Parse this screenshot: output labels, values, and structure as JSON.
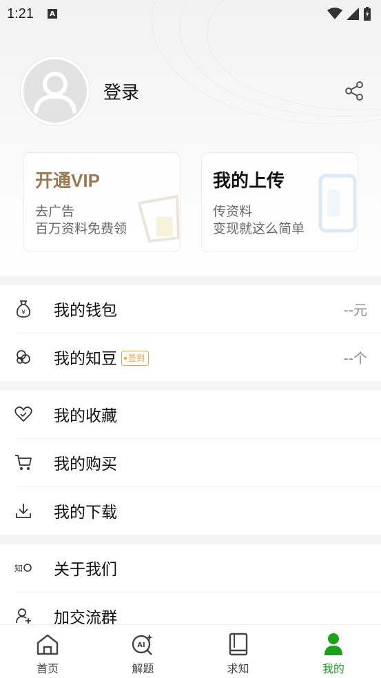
{
  "status_bar": {
    "time": "1:21",
    "notification_letter": "A"
  },
  "profile": {
    "login_label": "登录"
  },
  "cards": {
    "vip": {
      "title": "开通VIP",
      "line1": "去广告",
      "line2": "百万资料免费领"
    },
    "upload": {
      "title": "我的上传",
      "line1": "传资料",
      "line2": "变现就这么简单"
    }
  },
  "menu_group1": [
    {
      "label": "我的钱包",
      "value": "--元"
    },
    {
      "label": "我的知豆",
      "badge": "签到",
      "value": "--个"
    }
  ],
  "menu_group2": [
    {
      "label": "我的收藏"
    },
    {
      "label": "我的购买"
    },
    {
      "label": "我的下载"
    }
  ],
  "menu_group3": [
    {
      "label": "关于我们"
    },
    {
      "label": "加交流群"
    }
  ],
  "bottom_nav": [
    {
      "label": "首页",
      "icon": "home-icon"
    },
    {
      "label": "解题",
      "icon": "ai-search-icon"
    },
    {
      "label": "求知",
      "icon": "book-icon"
    },
    {
      "label": "我的",
      "icon": "user-icon",
      "active": true
    }
  ],
  "colors": {
    "accent": "#1aa31a",
    "vip_gold": "#9b7a52",
    "badge_orange": "#e8a33a"
  }
}
